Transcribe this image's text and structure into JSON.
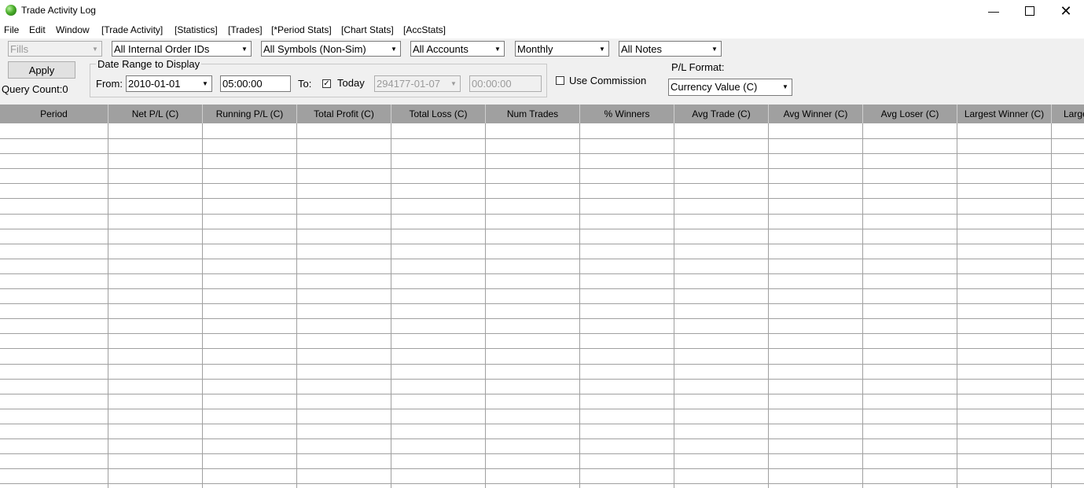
{
  "window": {
    "title": "Trade Activity Log",
    "minimize_icon": "minimize-icon",
    "maximize_icon": "maximize-icon",
    "close_icon": "close-icon"
  },
  "menu": [
    "File",
    "Edit",
    "Window",
    "[Trade Activity]",
    "[Statistics]",
    "[Trades]",
    "[*Period Stats]",
    "[Chart Stats]",
    "[AccStats]"
  ],
  "filters": {
    "type": "Fills",
    "order_ids": "All Internal Order IDs",
    "symbols": "All Symbols (Non-Sim)",
    "accounts": "All Accounts",
    "period": "Monthly",
    "notes": "All Notes"
  },
  "apply_label": "Apply",
  "query_count_label": "Query Count:",
  "query_count_value": "0",
  "date_range": {
    "group_label": "Date Range to Display",
    "from_label": "From:",
    "from_date": "2010-01-01",
    "from_time": "05:00:00",
    "to_label": "To:",
    "today_label": "Today",
    "today_checked": true,
    "to_date": "294177-01-07",
    "to_time": "00:00:00"
  },
  "use_commission_label": "Use Commission",
  "use_commission_checked": false,
  "pl_format": {
    "label": "P/L Format:",
    "value": "Currency Value (C)"
  },
  "table": {
    "columns": [
      "Period",
      "Net P/L (C)",
      "Running P/L (C)",
      "Total Profit (C)",
      "Total Loss (C)",
      "Num Trades",
      "% Winners",
      "Avg Trade (C)",
      "Avg Winner (C)",
      "Avg Loser (C)",
      "Largest Winner (C)",
      "Largest Loser (C)"
    ],
    "rows": []
  },
  "colors": {
    "header_bg": "#a0a0a0",
    "grid_line": "#a0a0a0",
    "window_bg": "#f0f0f0"
  }
}
